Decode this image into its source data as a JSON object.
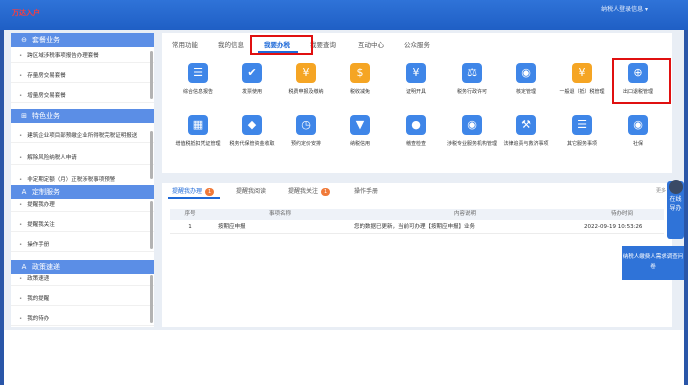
{
  "header": {
    "logo_text": "万达入户",
    "user_text": "纳税人登录信息 ▾"
  },
  "sidebar": {
    "sections": [
      {
        "title": "套餐业务",
        "icon": "⊖"
      },
      {
        "title": "特色业务",
        "icon": "⊞"
      },
      {
        "title": "定制服务",
        "icon": "A"
      },
      {
        "title": "政策速递",
        "icon": "A"
      }
    ],
    "items_a": [
      "跨区域涉税事项报告办理套餐",
      "存量房交易套餐",
      "增量房交易套餐"
    ],
    "items_b": [
      "建筑企业项目部预缴企业所得税完税证明报送",
      "解除风险纳税人申请",
      "非定期定额（月）正税涉税事项预警"
    ],
    "items_c": [
      "提醒我办理",
      "提醒我关注",
      "操作手册"
    ],
    "items_d": [
      "政策速递",
      "我的提醒",
      "我的待办"
    ]
  },
  "tabs": [
    "常用功能",
    "我的信息",
    "我要办税",
    "我要查询",
    "互动中心",
    "公众服务"
  ],
  "functions": [
    {
      "label": "综合信息报告",
      "icon": "clipboard-icon",
      "glyph": "☰",
      "color": "#3f86e8"
    },
    {
      "label": "发票使用",
      "icon": "invoice-check-icon",
      "glyph": "✔",
      "color": "#3f86e8"
    },
    {
      "label": "税费申报及缴纳",
      "icon": "tax-declare-icon",
      "glyph": "¥",
      "color": "#f5a524"
    },
    {
      "label": "税收减免",
      "icon": "coin-icon",
      "glyph": "$",
      "color": "#f5a524"
    },
    {
      "label": "证明开具",
      "icon": "certificate-icon",
      "glyph": "¥",
      "color": "#3f86e8"
    },
    {
      "label": "税务行政许可",
      "icon": "license-icon",
      "glyph": "⚖",
      "color": "#3f86e8"
    },
    {
      "label": "核定管理",
      "icon": "verify-user-icon",
      "glyph": "◉",
      "color": "#3f86e8"
    },
    {
      "label": "一般退（抵）税管理",
      "icon": "refund-icon",
      "glyph": "¥",
      "color": "#f5a524"
    },
    {
      "label": "出口退税管理",
      "icon": "export-refund-icon",
      "glyph": "⊕",
      "color": "#3f86e8"
    },
    {
      "label": "增值税抵扣凭证管理",
      "icon": "deduct-voucher-icon",
      "glyph": "▦",
      "color": "#3f86e8"
    },
    {
      "label": "税务代保管资金收取",
      "icon": "fund-icon",
      "glyph": "◆",
      "color": "#3f86e8"
    },
    {
      "label": "预约定价安排",
      "icon": "pricing-icon",
      "glyph": "◷",
      "color": "#3f86e8"
    },
    {
      "label": "纳税信用",
      "icon": "credit-icon",
      "glyph": "▼",
      "color": "#3f86e8"
    },
    {
      "label": "稽查检查",
      "icon": "inspect-icon",
      "glyph": "●",
      "color": "#3f86e8"
    },
    {
      "label": "涉税专业服务机构管理",
      "icon": "agency-icon",
      "glyph": "◉",
      "color": "#3f86e8"
    },
    {
      "label": "法律追责与救济事项",
      "icon": "legal-hammer-icon",
      "glyph": "⚒",
      "color": "#3f86e8"
    },
    {
      "label": "其它服务事项",
      "icon": "other-service-icon",
      "glyph": "☰",
      "color": "#3f86e8"
    },
    {
      "label": "社保",
      "icon": "social-security-icon",
      "glyph": "◉",
      "color": "#3f86e8"
    }
  ],
  "todo": {
    "tabs": [
      {
        "label": "提醒我办理",
        "badge": "1"
      },
      {
        "label": "提醒我阅读",
        "badge": ""
      },
      {
        "label": "提醒我关注",
        "badge": "1"
      },
      {
        "label": "操作手册",
        "badge": ""
      }
    ],
    "more": "更多",
    "columns": [
      "序号",
      "事项名称",
      "内容说明",
      "待办时间"
    ],
    "rows": [
      {
        "no": "1",
        "name": "按期应申报",
        "desc": "您的数据已更新，当前可办理【按期应申报】业务",
        "time": "2022-09-19 10:53:26"
      }
    ]
  },
  "float": {
    "nav": "在线导办",
    "box": "纳税人缴费人需求调查问卷"
  }
}
